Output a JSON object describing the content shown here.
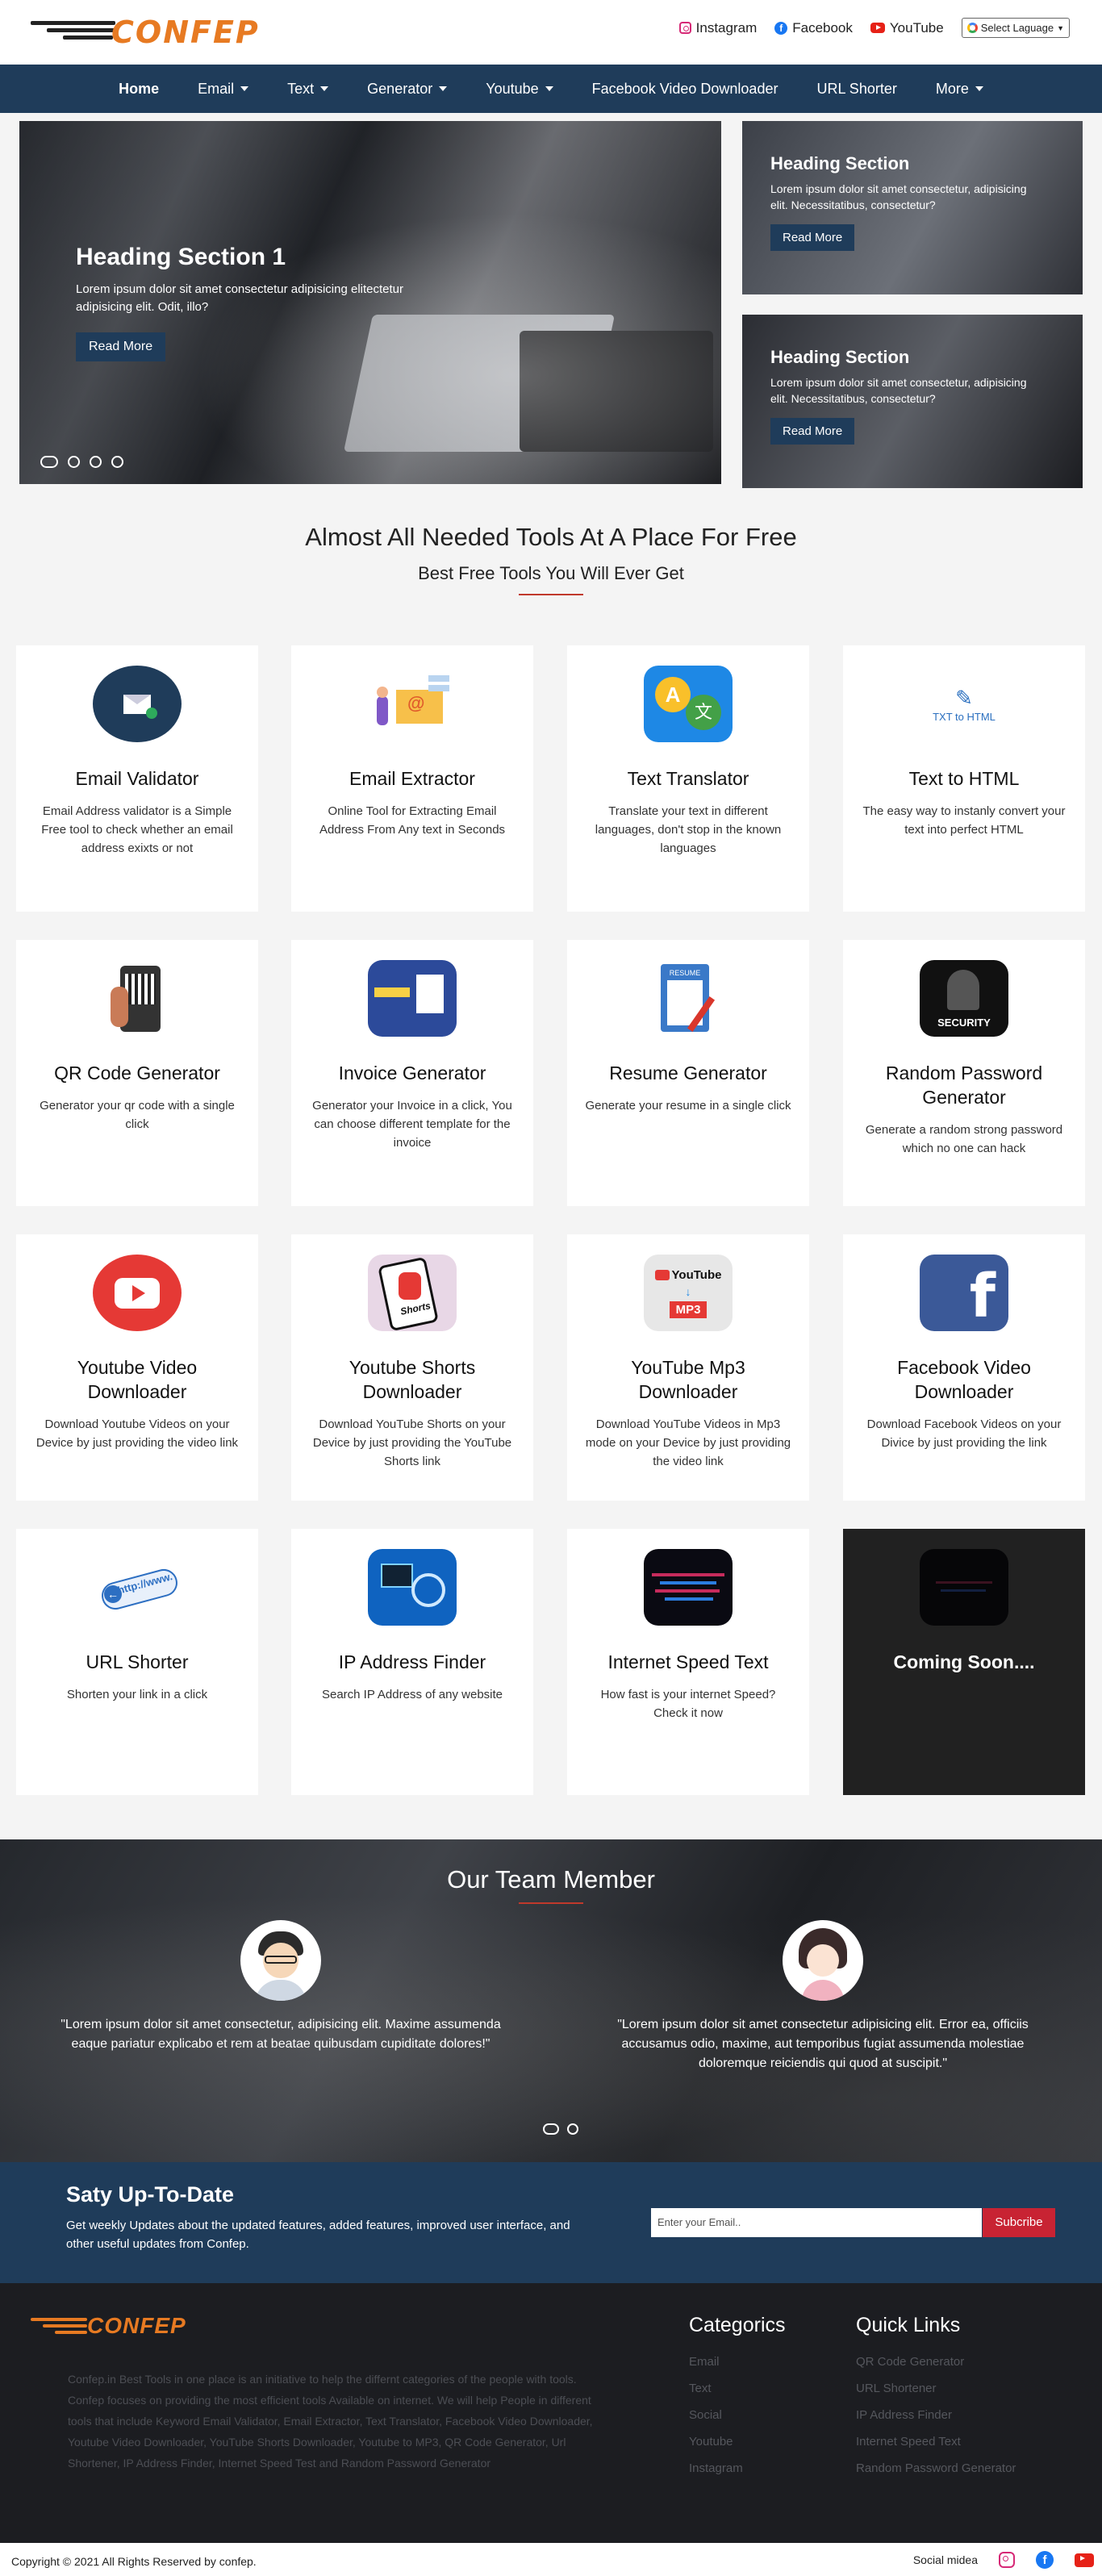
{
  "brand": {
    "logo_text": "CONFEP"
  },
  "topbar": {
    "links": [
      {
        "label": "Instagram",
        "icon": "instagram-icon"
      },
      {
        "label": "Facebook",
        "icon": "facebook-icon"
      },
      {
        "label": "YouTube",
        "icon": "youtube-icon"
      }
    ],
    "language_select": "Select Laguage"
  },
  "nav": {
    "items": [
      {
        "label": "Home",
        "dropdown": false
      },
      {
        "label": "Email",
        "dropdown": true
      },
      {
        "label": "Text",
        "dropdown": true
      },
      {
        "label": "Generator",
        "dropdown": true
      },
      {
        "label": "Youtube",
        "dropdown": true
      },
      {
        "label": "Facebook Video Downloader",
        "dropdown": false
      },
      {
        "label": "URL Shorter",
        "dropdown": false
      },
      {
        "label": "More",
        "dropdown": true
      }
    ]
  },
  "hero": {
    "main": {
      "title": "Heading Section 1",
      "text": "Lorem ipsum dolor sit amet consectetur adipisicing elitectetur adipisicing elit. Odit, illo?",
      "button": "Read More"
    },
    "side": [
      {
        "title": "Heading Section",
        "text": "Lorem ipsum dolor sit amet consectetur, adipisicing elit. Necessitatibus, consectetur?",
        "button": "Read More"
      },
      {
        "title": "Heading Section",
        "text": "Lorem ipsum dolor sit amet consectetur, adipisicing elit. Necessitatibus, consectetur?",
        "button": "Read More"
      }
    ]
  },
  "tools_section": {
    "title": "Almost All Needed Tools At A Place For Free",
    "subtitle": "Best Free Tools You Will Ever Get"
  },
  "tools": [
    {
      "title": "Email Validator",
      "desc": "Email Address validator is a Simple Free tool to check whether an email address exixts or not",
      "icon": "email-validator-icon"
    },
    {
      "title": "Email Extractor",
      "desc": "Online Tool for Extracting Email Address From Any text in Seconds",
      "icon": "email-extractor-icon"
    },
    {
      "title": "Text Translator",
      "desc": "Translate your text in different languages, don't stop in the known languages",
      "icon": "translate-icon"
    },
    {
      "title": "Text to HTML",
      "desc": "The easy way to instanly convert your text into perfect HTML",
      "icon": "text-to-html-icon",
      "icon_text": "TXT to HTML"
    },
    {
      "title": "QR Code Generator",
      "desc": "Generator your qr code with a single click",
      "icon": "qr-code-icon"
    },
    {
      "title": "Invoice Generator",
      "desc": "Generator your Invoice in a click, You can choose different template for the invoice",
      "icon": "invoice-icon"
    },
    {
      "title": "Resume Generator",
      "desc": "Generate your resume in a single click",
      "icon": "resume-icon",
      "icon_text": "RESUME"
    },
    {
      "title": "Random Password Generator",
      "desc": "Generate a random strong password which no one can hack",
      "icon": "security-icon",
      "icon_text": "SECURITY"
    },
    {
      "title": "Youtube Video Downloader",
      "desc": "Download Youtube Videos on your Device by just providing the video link",
      "icon": "youtube-play-icon"
    },
    {
      "title": "Youtube Shorts Downloader",
      "desc": "Download YouTube Shorts on your Device by just providing the YouTube Shorts link",
      "icon": "youtube-shorts-icon",
      "icon_text": "Shorts"
    },
    {
      "title": "YouTube Mp3 Downloader",
      "desc": "Download YouTube Videos in Mp3 mode on your Device by just providing the video link",
      "icon": "youtube-mp3-icon",
      "icon_text": "YouTube",
      "icon_text2": "MP3"
    },
    {
      "title": "Facebook Video Downloader",
      "desc": "Download Facebook Videos on your Divice by just providing the link",
      "icon": "facebook-logo-icon"
    },
    {
      "title": "URL Shorter",
      "desc": "Shorten your link in a click",
      "icon": "url-icon",
      "icon_text": "http://www."
    },
    {
      "title": "IP Address Finder",
      "desc": "Search IP Address of any website",
      "icon": "ip-finder-icon"
    },
    {
      "title": "Internet Speed Text",
      "desc": "How fast is your internet Speed? Check it now",
      "icon": "speed-icon"
    },
    {
      "title": "Coming Soon....",
      "desc": "",
      "icon": "coming-soon-icon"
    }
  ],
  "team": {
    "title": "Our Team Member",
    "members": [
      {
        "quote": "\"Lorem ipsum dolor sit amet consectetur, adipisicing elit. Maxime assumenda eaque pariatur explicabo et rem at beatae quibusdam cupiditate dolores!\""
      },
      {
        "quote": "\"Lorem ipsum dolor sit amet consectetur adipisicing elit. Error ea, officiis accusamus odio, maxime, aut temporibus fugiat assumenda molestiae doloremque reiciendis qui quod at suscipit.\""
      }
    ]
  },
  "newsletter": {
    "title": "Saty Up-To-Date",
    "text": "Get weekly Updates about the updated features, added features, improved user interface, and other useful updates from Confep.",
    "placeholder": "Enter your Email..",
    "button": "Subcribe"
  },
  "footer": {
    "about": "Confep.in Best Tools in one place is an initiative to help the differnt categories of the people with tools. Confep focuses on providing the most efficient tools Available on internet. We will help People in different tools that include Keyword Email Validator, Email Extractor, Text Translator, Facebook Video Downloader, Youtube Video Downloader, YouTube Shorts Downloader, Youtube to MP3, QR Code Generator, Url Shortener, IP Address Finder, Internet Speed Test and Random Password Generator",
    "categories_title": "Categorics",
    "categories": [
      "Email",
      "Text",
      "Social",
      "Youtube",
      "Instagram"
    ],
    "quick_title": "Quick Links",
    "quick_links": [
      "QR Code Generator",
      "URL Shortener",
      "IP Address Finder",
      "Internet Speed Text",
      "Random Password Generator"
    ]
  },
  "bottombar": {
    "copyright": "Copyright © 2021 All Rights Reserved by confep.",
    "social_label": "Social midea"
  },
  "colors": {
    "primary": "#1f3c5a",
    "accent": "#e77a22",
    "danger": "#c82333",
    "footer_bg": "#1c1d21"
  }
}
